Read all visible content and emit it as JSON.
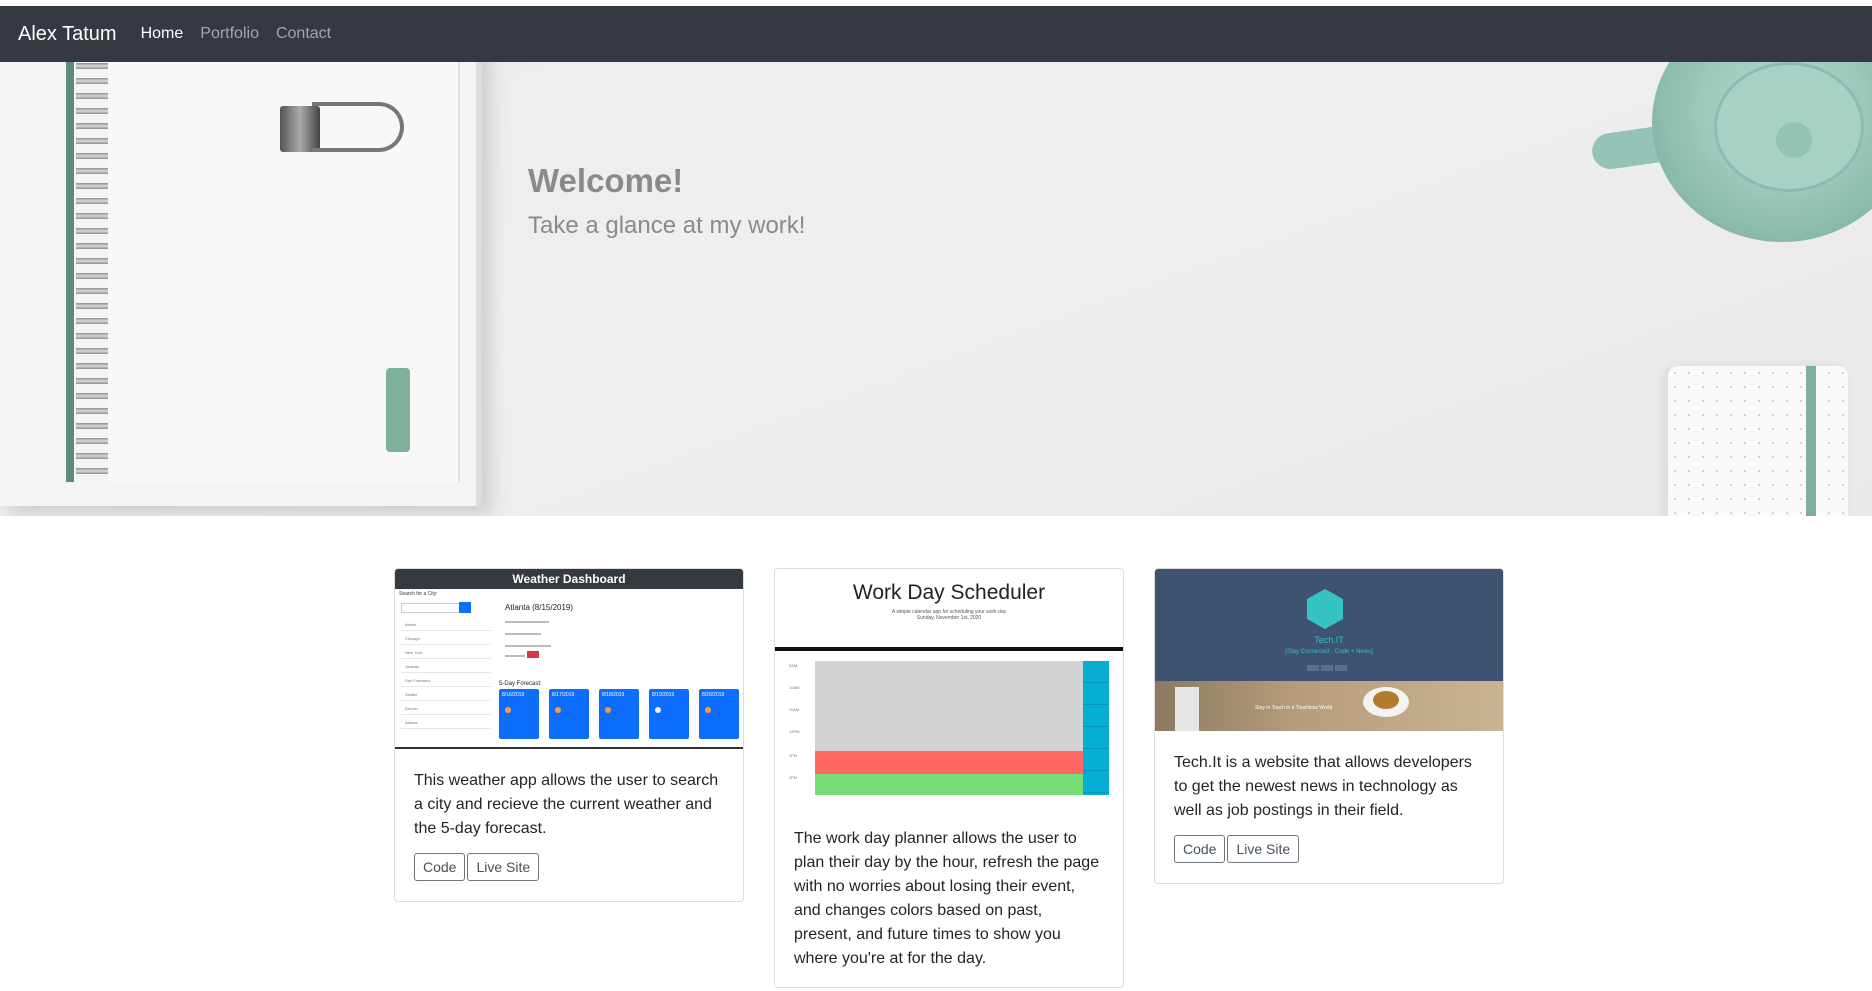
{
  "navbar": {
    "brand": "Alex Tatum",
    "links": [
      "Home",
      "Portfolio",
      "Contact"
    ],
    "active": "Home"
  },
  "hero": {
    "title": "Welcome!",
    "subtitle": "Take a glance at my work!"
  },
  "cards": [
    {
      "thumbnail": {
        "header": "Weather Dashboard",
        "search_label": "Search for a City:",
        "cities": [
          "Austin",
          "Chicago",
          "New York",
          "Orlando",
          "San Francisco",
          "Seattle",
          "Denver",
          "Atlanta"
        ],
        "current": "Atlanta (8/15/2019)",
        "forecast_label": "5-Day Forecast:",
        "forecast_dates": [
          "8/16/2019",
          "8/17/2019",
          "8/18/2019",
          "8/19/2019",
          "8/20/2019"
        ]
      },
      "text": "This weather app allows the user to search a city and recieve the current weather and the 5-day forecast.",
      "buttons": [
        "Code",
        "Live Site"
      ]
    },
    {
      "thumbnail": {
        "title": "Work Day Scheduler",
        "subtitle": "A simple calendar app for scheduling your work day",
        "date": "Sunday, November 1st, 2020",
        "hours": [
          "9AM",
          "10AM",
          "11AM",
          "12PM",
          "1PM",
          "2PM"
        ]
      },
      "text": "The work day planner allows the user to plan their day by the hour, refresh the page with no worries about losing their event, and changes colors based on past, present, and future times to show you where you're at for the day.",
      "buttons": [
        "Code",
        "Live Site"
      ]
    },
    {
      "thumbnail": {
        "name": "Tech.IT",
        "tagline": "[Stay Connected - Code + News]",
        "caption": "Stay in Touch in a Touchless World"
      },
      "text": "Tech.It is a website that allows developers to get the newest news in technology as well as job postings in their field.",
      "buttons": [
        "Code",
        "Live Site"
      ]
    }
  ],
  "colors": {
    "navbar_bg": "#343a40",
    "hero_text": "#8a8a8a",
    "scheduler_past": "#d3d3d3",
    "scheduler_present": "#ff6961",
    "scheduler_future": "#77dd77",
    "weather_card_blue": "#0d6efd",
    "techit_teal": "#35c2c2"
  }
}
